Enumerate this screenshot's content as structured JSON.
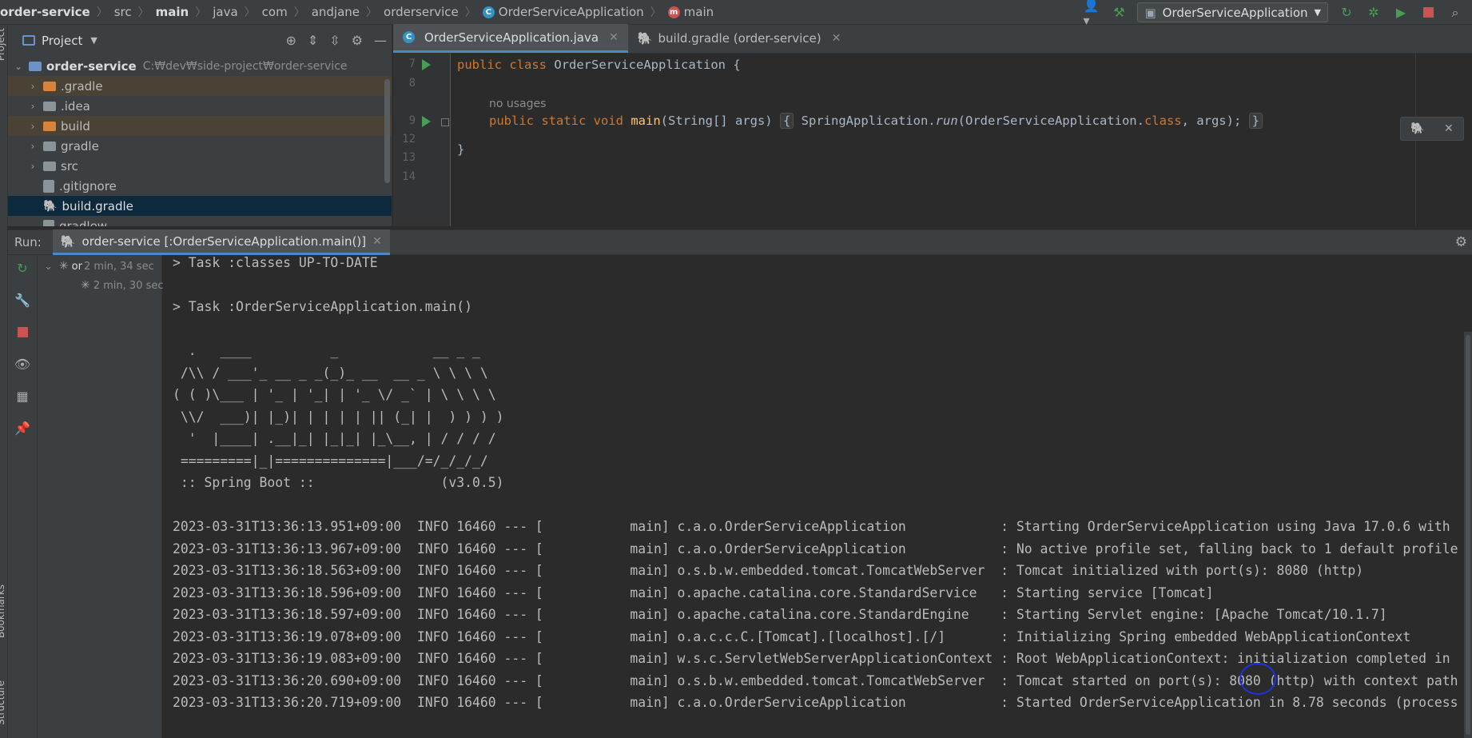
{
  "navbar": {
    "breadcrumbs": [
      "order-service",
      "src",
      "main",
      "java",
      "com",
      "andjane",
      "orderservice",
      "OrderServiceApplication",
      "main"
    ],
    "class_icon": "C",
    "method_icon": "m",
    "run_config": "OrderServiceApplication",
    "icons": [
      "user-icon",
      "build-hammer-icon",
      "rerun-icon",
      "debug-icon",
      "coverage-icon",
      "stop-icon",
      "search-icon"
    ]
  },
  "left_strip": {
    "project_label": "Project",
    "bookmarks_label": "Bookmarks",
    "structure_label": "Structure"
  },
  "project": {
    "title": "Project",
    "root": {
      "name": "order-service",
      "path": "C:₩dev₩side-project₩order-service"
    },
    "items": [
      {
        "name": ".gradle",
        "type": "folder-excluded"
      },
      {
        "name": ".idea",
        "type": "folder"
      },
      {
        "name": "build",
        "type": "folder-excluded"
      },
      {
        "name": "gradle",
        "type": "folder"
      },
      {
        "name": "src",
        "type": "folder"
      },
      {
        "name": ".gitignore",
        "type": "file"
      },
      {
        "name": "build.gradle",
        "type": "gradle"
      },
      {
        "name": "gradlew",
        "type": "file"
      }
    ]
  },
  "editor": {
    "tabs": [
      {
        "label": "OrderServiceApplication.java",
        "active": true
      },
      {
        "label": "build.gradle (order-service)",
        "active": false
      }
    ],
    "line_numbers": [
      "7",
      "8",
      "9",
      "12",
      "13",
      "14"
    ],
    "code": {
      "line7_kw1": "public",
      "line7_kw2": "class",
      "line7_rest": "OrderServiceApplication {",
      "hint": "no usages",
      "line9_kw": "public static void",
      "line9_fn": "main",
      "line9_sig": "(String[] args)",
      "line9_open": "{",
      "line9_call_obj": "SpringApplication.",
      "line9_call_fn": "run",
      "line9_args_a": "(OrderServiceApplication.",
      "line9_args_kw": "class",
      "line9_args_b": ", args);",
      "line9_close": "}",
      "line13": "}"
    }
  },
  "run": {
    "label": "Run:",
    "tab": "order-service [:OrderServiceApplication.main()]",
    "tree": [
      {
        "name": "or",
        "time": "2 min, 34 sec"
      },
      {
        "name": "",
        "time": "2 min, 30 sec"
      }
    ]
  },
  "console": {
    "lines": [
      "> Task :classes UP-TO-DATE",
      "",
      "> Task :OrderServiceApplication.main()",
      "",
      "  .   ____          _            __ _ _",
      " /\\\\ / ___'_ __ _ _(_)_ __  __ _ \\ \\ \\ \\",
      "( ( )\\___ | '_ | '_| | '_ \\/ _` | \\ \\ \\ \\",
      " \\\\/  ___)| |_)| | | | | || (_| |  ) ) ) )",
      "  '  |____| .__|_| |_|_| |_\\__, | / / / /",
      " =========|_|==============|___/=/_/_/_/",
      " :: Spring Boot ::                (v3.0.5)",
      "",
      "2023-03-31T13:36:13.951+09:00  INFO 16460 --- [           main] c.a.o.OrderServiceApplication            : Starting OrderServiceApplication using Java 17.0.6 with",
      "2023-03-31T13:36:13.967+09:00  INFO 16460 --- [           main] c.a.o.OrderServiceApplication            : No active profile set, falling back to 1 default profile",
      "2023-03-31T13:36:18.563+09:00  INFO 16460 --- [           main] o.s.b.w.embedded.tomcat.TomcatWebServer  : Tomcat initialized with port(s): 8080 (http)",
      "2023-03-31T13:36:18.596+09:00  INFO 16460 --- [           main] o.apache.catalina.core.StandardService   : Starting service [Tomcat]",
      "2023-03-31T13:36:18.597+09:00  INFO 16460 --- [           main] o.apache.catalina.core.StandardEngine    : Starting Servlet engine: [Apache Tomcat/10.1.7]",
      "2023-03-31T13:36:19.078+09:00  INFO 16460 --- [           main] o.a.c.c.C.[Tomcat].[localhost].[/]       : Initializing Spring embedded WebApplicationContext",
      "2023-03-31T13:36:19.083+09:00  INFO 16460 --- [           main] w.s.c.ServletWebServerApplicationContext : Root WebApplicationContext: initialization completed in",
      "2023-03-31T13:36:20.690+09:00  INFO 16460 --- [           main] o.s.b.w.embedded.tomcat.TomcatWebServer  : Tomcat started on port(s): 8080 (http) with context path",
      "2023-03-31T13:36:20.719+09:00  INFO 16460 --- [           main] c.a.o.OrderServiceApplication            : Started OrderServiceApplication in 8.78 seconds (process"
    ]
  },
  "colors": {
    "accent": "#4a88c7",
    "run_green": "#499c54",
    "stop_red": "#c75450",
    "annotation_circle": "#1d32e0"
  }
}
